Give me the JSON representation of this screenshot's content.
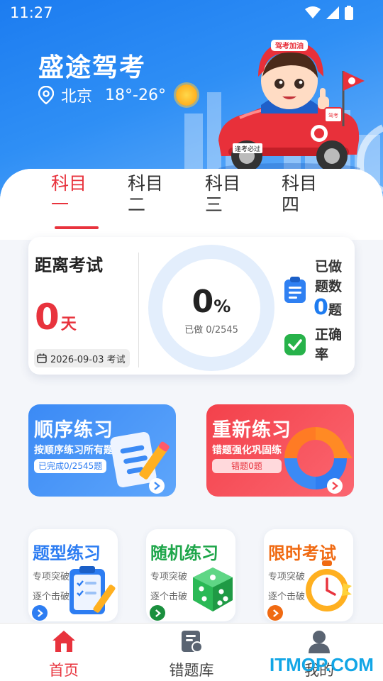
{
  "status_bar": {
    "time": "11:27"
  },
  "header": {
    "app_title": "盛途驾考",
    "city": "北京",
    "temperature": "18°-26°",
    "weather_icon": "sun-icon",
    "mascot_helmet_text": "驾考加油",
    "mascot_car_plate": "逢考必过",
    "mascot_flag_text": "驾考"
  },
  "tabs": [
    {
      "label": "科目一",
      "active": true
    },
    {
      "label": "科目二",
      "active": false
    },
    {
      "label": "科目三",
      "active": false
    },
    {
      "label": "科目四",
      "active": false
    }
  ],
  "stats": {
    "countdown_title": "距离考试",
    "countdown_days": "0",
    "countdown_unit": "天",
    "exam_date": "2026-09-03 考试",
    "progress_percent": "0",
    "progress_percent_sign": "%",
    "progress_fraction": 0,
    "progress_sub": "已做 0/2545",
    "done_label": "已做题数",
    "done_count": "0",
    "done_unit": "题",
    "accuracy_label": "正确率"
  },
  "practice": {
    "sequential": {
      "title": "顺序练习",
      "subtitle": "按顺序练习所有题",
      "badge": "已完成0/2545题"
    },
    "redo": {
      "title": "重新练习",
      "subtitle": "错题强化巩固练",
      "badge": "错题0题"
    }
  },
  "modes": [
    {
      "title": "题型练习",
      "line1": "专项突破",
      "line2": "逐个击破",
      "color": "#2d7df2"
    },
    {
      "title": "随机练习",
      "line1": "专项突破",
      "line2": "逐个击破",
      "color": "#1ea64a"
    },
    {
      "title": "限时考试",
      "line1": "专项突破",
      "line2": "逐个击破",
      "color": "#f06a12"
    }
  ],
  "bottom_nav": [
    {
      "label": "首页",
      "icon": "home-icon",
      "active": true
    },
    {
      "label": "错题库",
      "icon": "wrong-book-icon",
      "active": false
    },
    {
      "label": "我的",
      "icon": "user-icon",
      "active": false
    }
  ],
  "watermark": "ITMOP.COM",
  "colors": {
    "accent_red": "#e8333d",
    "primary_blue": "#1f7cf0",
    "green": "#1ea64a",
    "orange": "#f06a12"
  }
}
